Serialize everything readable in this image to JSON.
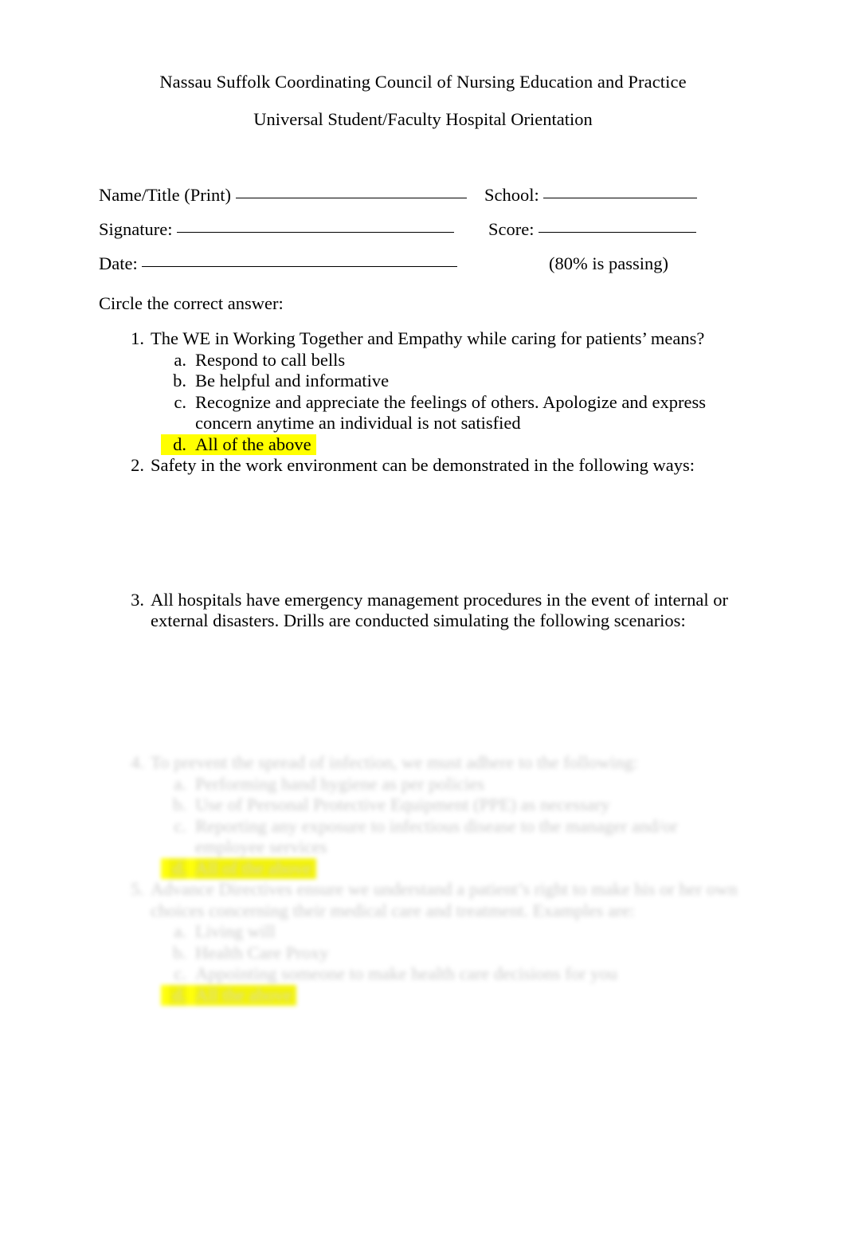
{
  "document": {
    "title": "Nassau Suffolk Coordinating Council of Nursing Education and Practice",
    "subtitle": "Universal Student/Faculty Hospital Orientation"
  },
  "form": {
    "name_label": "Name/Title (Print)",
    "school_label": "School:",
    "signature_label": "Signature:",
    "score_label": "Score:",
    "date_label": "Date:",
    "passing_note": "(80% is passing)"
  },
  "instruction": "Circle the correct answer:",
  "highlight_color": "#ffff00",
  "questions": [
    {
      "number": "1.",
      "text": "The WE in Working Together and Empathy while caring for patients’ means?",
      "options": [
        {
          "letter": "a.",
          "text": "Respond to call bells",
          "highlighted": false
        },
        {
          "letter": "b.",
          "text": "Be helpful and informative",
          "highlighted": false
        },
        {
          "letter": "c.",
          "text": "Recognize and appreciate the feelings of others. Apologize and express concern anytime an individual is not satisfied",
          "highlighted": false
        },
        {
          "letter": "d.",
          "text": "All of the above",
          "highlighted": true
        }
      ]
    },
    {
      "number": "2.",
      "text": "Safety in the work environment can be demonstrated in the following ways:",
      "options": []
    },
    {
      "number": "3.",
      "text": "All hospitals have emergency management procedures in the event of internal or external disasters. Drills are conducted simulating the following scenarios:",
      "options": []
    }
  ],
  "faded_questions": [
    {
      "number": "4.",
      "text": "To prevent the spread of infection, we must adhere to the following:",
      "options": [
        {
          "letter": "a.",
          "text": "Performing hand hygiene as per policies",
          "highlighted": false
        },
        {
          "letter": "b.",
          "text": "Use of Personal Protective Equipment (PPE) as necessary",
          "highlighted": false
        },
        {
          "letter": "c.",
          "text": "Reporting any exposure to infectious disease to the manager and/or employee services",
          "highlighted": false
        },
        {
          "letter": "d.",
          "text": "All of the above",
          "highlighted": true
        }
      ]
    },
    {
      "number": "5.",
      "text": "Advance Directives ensure we understand a patient’s right to make his or her own choices concerning their medical care and treatment. Examples are:",
      "options": [
        {
          "letter": "a.",
          "text": "Living will",
          "highlighted": false
        },
        {
          "letter": "b.",
          "text": "Health Care Proxy",
          "highlighted": false
        },
        {
          "letter": "c.",
          "text": "Appointing someone to make health care decisions for you",
          "highlighted": false
        },
        {
          "letter": "d.",
          "text": "All the above",
          "highlighted": true
        }
      ]
    }
  ]
}
